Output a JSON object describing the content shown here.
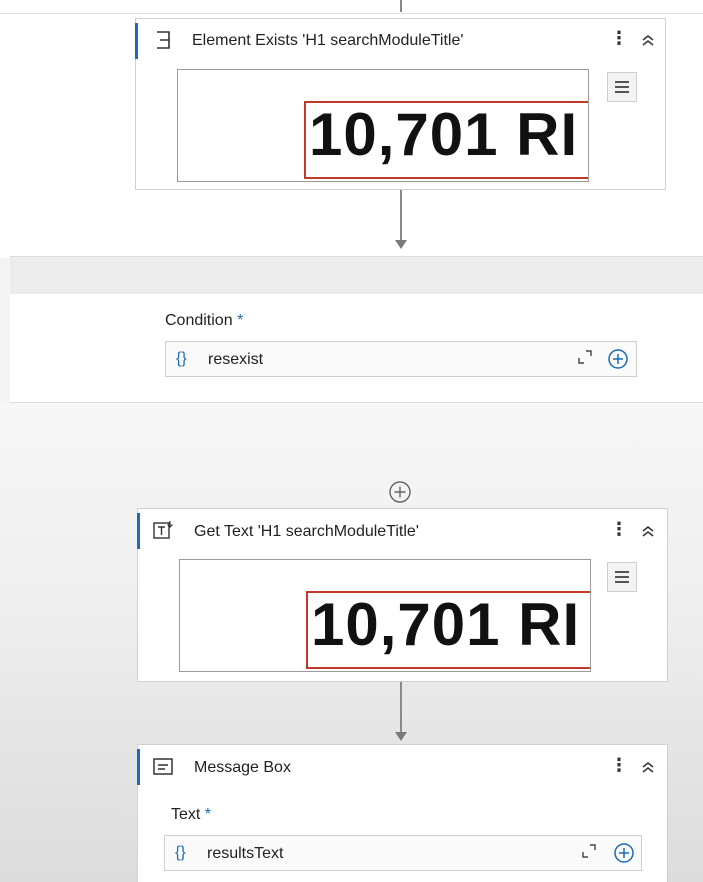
{
  "activities": {
    "element_exists": {
      "title": "Element Exists 'H1  searchModuleTitle'",
      "preview_text": "10,701 RI",
      "icon": "element-exists-icon"
    },
    "get_text": {
      "title": "Get Text 'H1  searchModuleTitle'",
      "preview_text": "10,701 RI",
      "icon": "get-text-icon"
    },
    "message_box": {
      "title": "Message Box",
      "icon": "message-box-icon",
      "field_label": "Text",
      "required_mark": "*",
      "field_value": "resultsText",
      "field_prefix": "{}"
    }
  },
  "condition": {
    "label": "Condition",
    "required_mark": "*",
    "value": "resexist",
    "prefix": "{}"
  },
  "colors": {
    "accent": "#1b6bb8",
    "highlight": "#c0392b"
  }
}
